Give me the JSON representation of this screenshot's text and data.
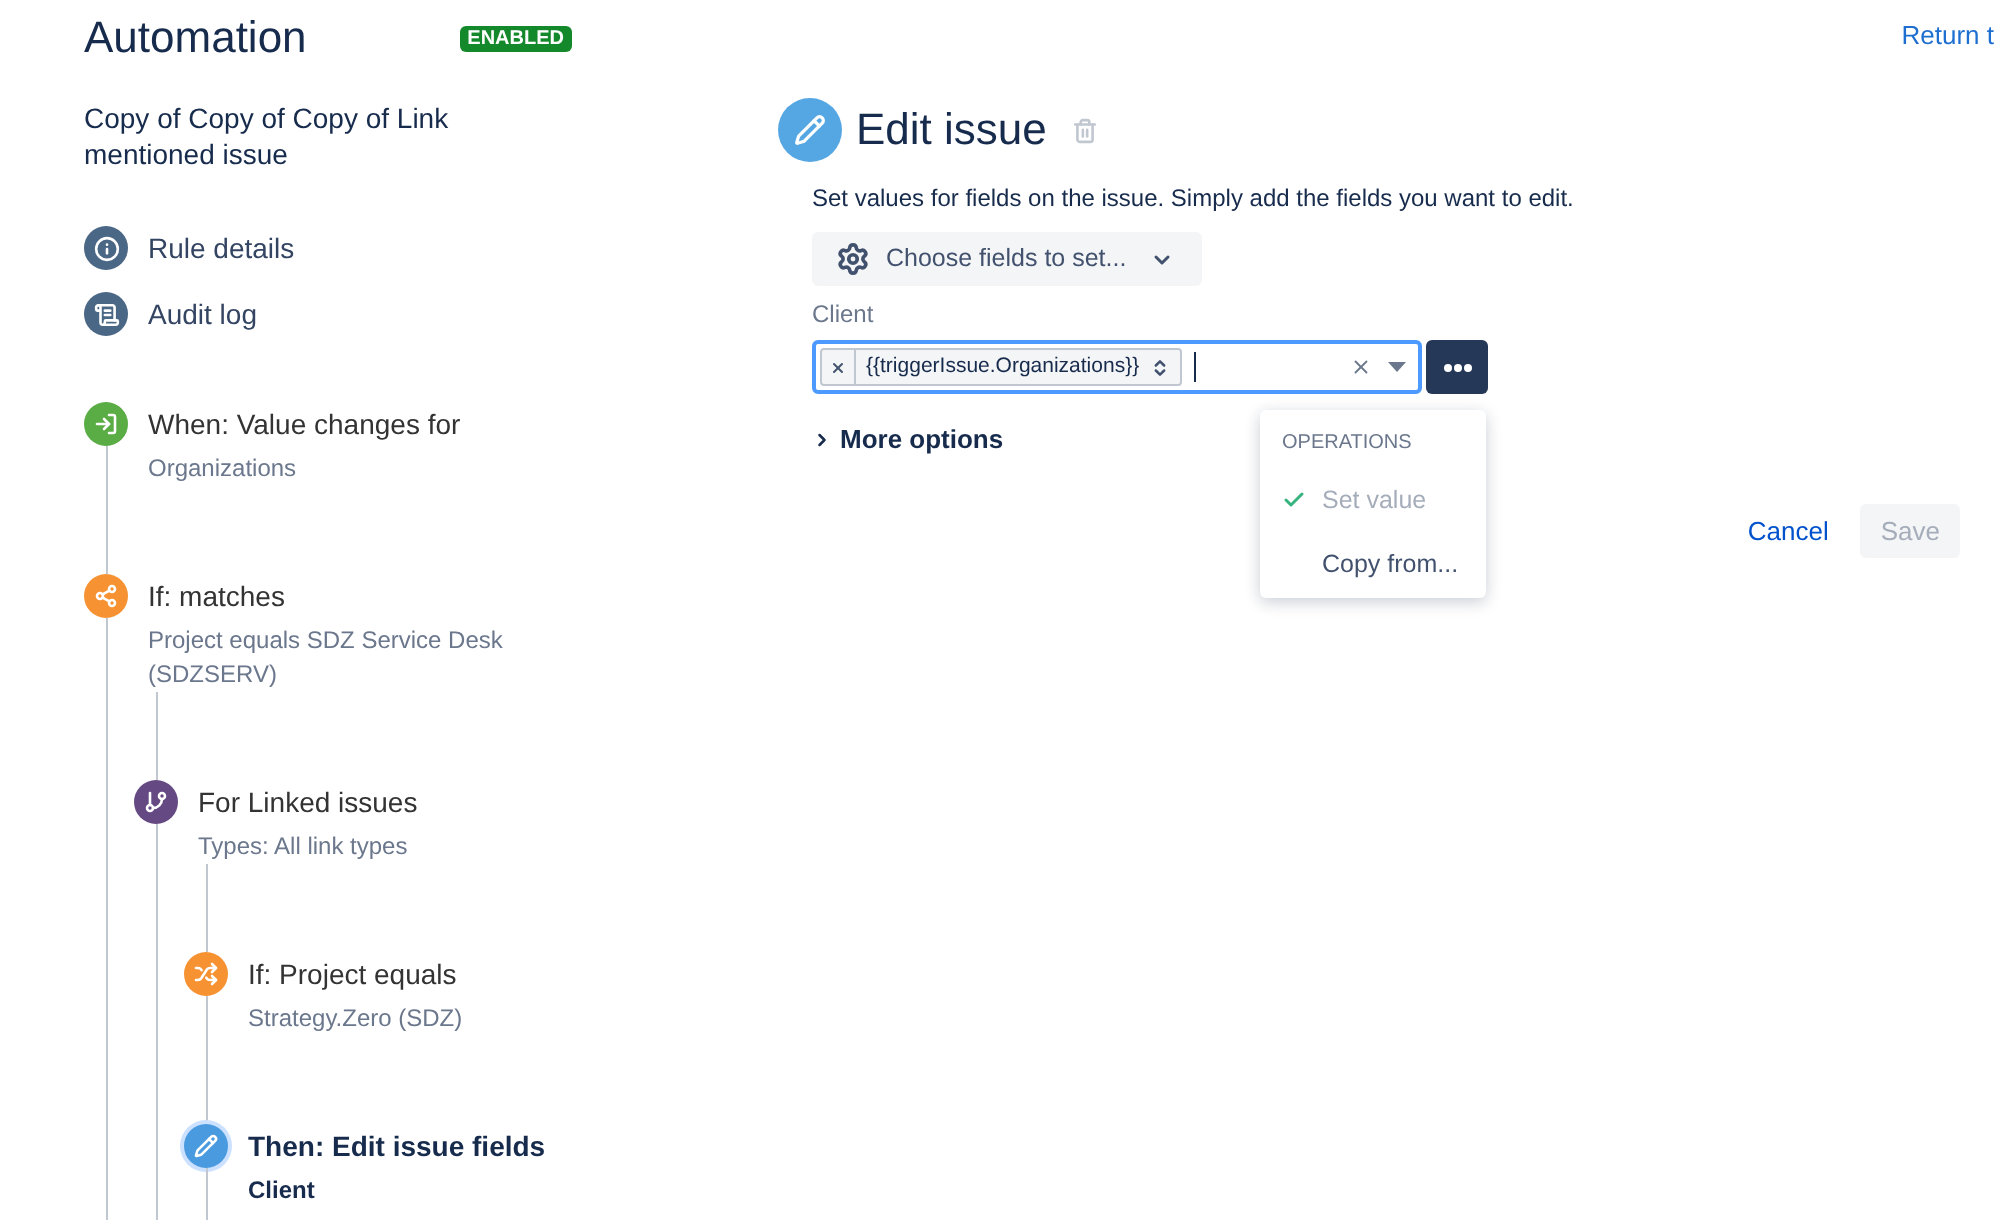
{
  "header": {
    "title": "Automation",
    "status": "ENABLED",
    "return_link": "Return t"
  },
  "sidebar": {
    "rule_name": "Copy of Copy of Copy of Link mentioned issue",
    "nav_items": [
      {
        "label": "Rule details",
        "kind": "details"
      },
      {
        "label": "Audit log",
        "kind": "log"
      }
    ],
    "rule_components": [
      {
        "kind": "trigger",
        "title": "When: Value changes for",
        "subtitle": "Organizations",
        "selected": false
      },
      {
        "kind": "condition",
        "title": "If: matches",
        "subtitle": "Project equals SDZ Service Desk (SDZSERV)",
        "selected": false,
        "children": [
          {
            "kind": "branch",
            "title": "For Linked issues",
            "subtitle": "Types: All link types",
            "selected": false,
            "children": [
              {
                "kind": "project-condition",
                "title": "If: Project equals",
                "subtitle": "Strategy.Zero (SDZ)",
                "selected": false
              },
              {
                "kind": "action",
                "title": "Then: Edit issue fields",
                "subtitle": "Client",
                "selected": true
              }
            ]
          }
        ]
      }
    ]
  },
  "editor": {
    "title": "Edit issue",
    "description": "Set values for fields on the issue. Simply add the fields you want to edit.",
    "choose_fields_button": "Choose fields to set...",
    "fields": [
      {
        "label": "Client",
        "values": [
          "{{triggerIssue.Organizations}}"
        ],
        "operations_menu": {
          "heading": "OPERATIONS",
          "items": [
            {
              "label": "Set value",
              "selected": true
            },
            {
              "label": "Copy from...",
              "selected": false
            }
          ]
        }
      }
    ],
    "more_options": {
      "label": "More options",
      "expanded": false
    },
    "buttons": [
      {
        "label": "Cancel",
        "kind": "link",
        "disabled": false
      },
      {
        "label": "Save",
        "kind": "primary",
        "disabled": true
      }
    ]
  }
}
